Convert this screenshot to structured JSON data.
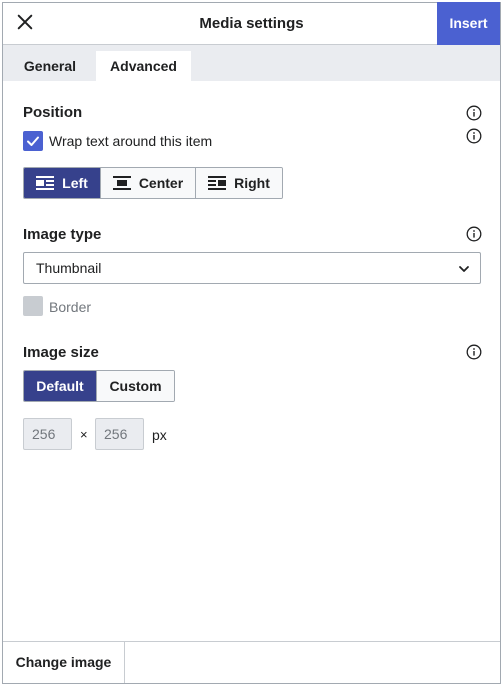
{
  "header": {
    "title": "Media settings",
    "insert_label": "Insert",
    "close_icon": "close-icon"
  },
  "tabs": [
    {
      "label": "General",
      "active": false
    },
    {
      "label": "Advanced",
      "active": true
    }
  ],
  "position": {
    "label": "Position",
    "wrap_label": "Wrap text around this item",
    "wrap_checked": true,
    "alignment_options": [
      {
        "label": "Left",
        "icon": "align-left-icon",
        "active": true
      },
      {
        "label": "Center",
        "icon": "align-center-icon",
        "active": false
      },
      {
        "label": "Right",
        "icon": "align-right-icon",
        "active": false
      }
    ]
  },
  "image_type": {
    "label": "Image type",
    "selected": "Thumbnail",
    "border_label": "Border",
    "border_checked": false,
    "border_disabled": true
  },
  "image_size": {
    "label": "Image size",
    "options": [
      {
        "label": "Default",
        "active": true
      },
      {
        "label": "Custom",
        "active": false
      }
    ],
    "width_placeholder": "256",
    "height_placeholder": "256",
    "separator": "×",
    "unit": "px"
  },
  "footer": {
    "change_image_label": "Change image"
  },
  "colors": {
    "accent": "#4b61d1",
    "active_segment": "#36418c"
  }
}
